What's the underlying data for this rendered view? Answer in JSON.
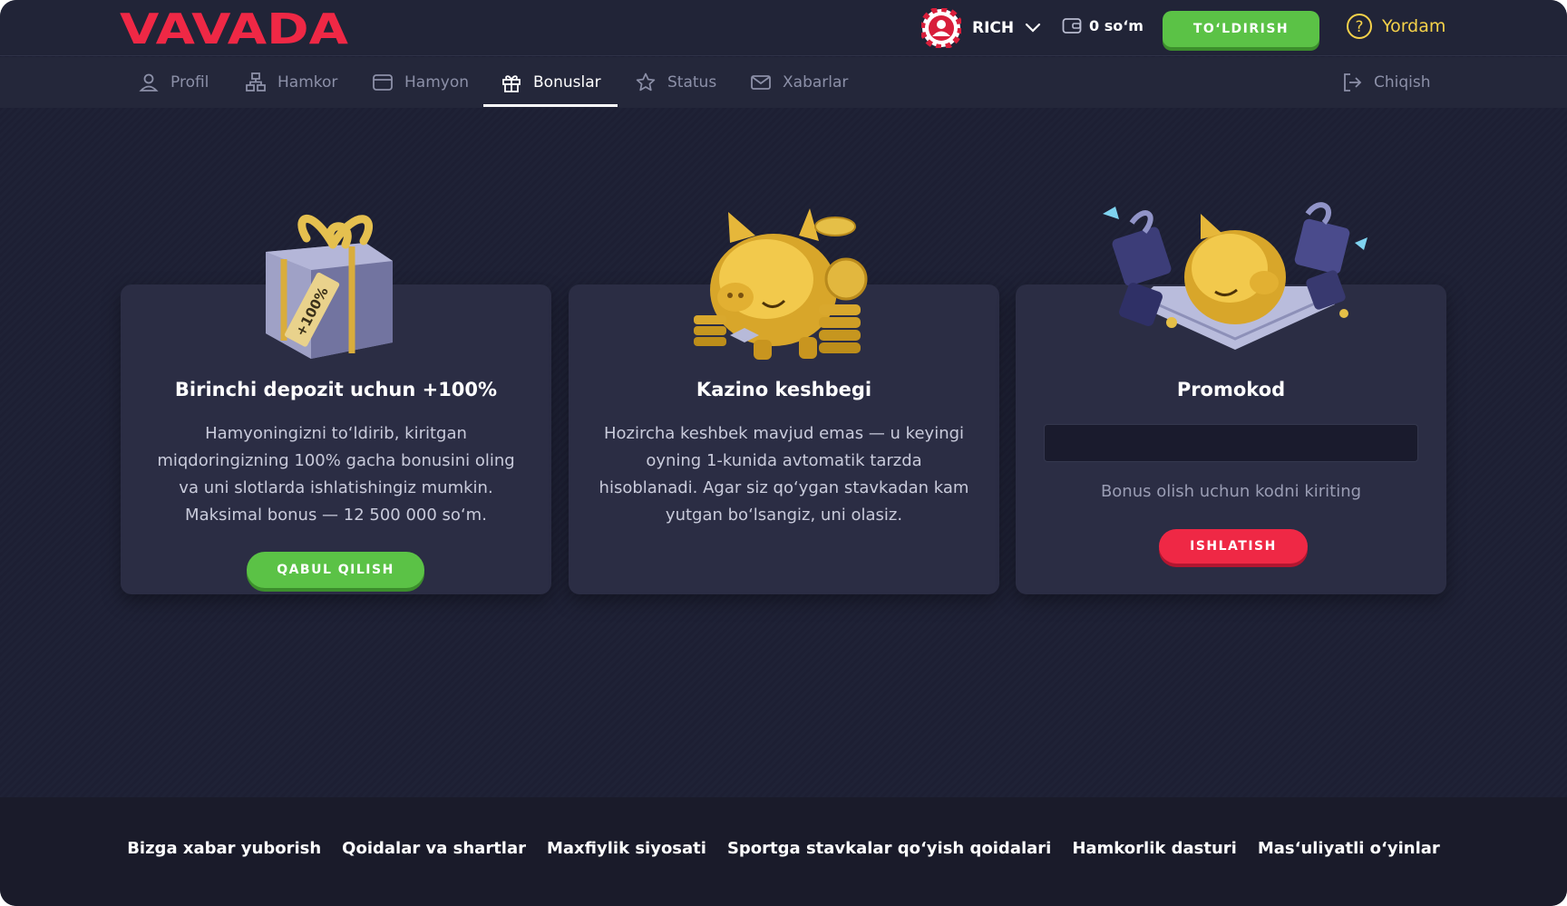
{
  "header": {
    "logo_text": "VAVADA",
    "username": "RICH",
    "balance": "0 so‘m",
    "topup_label": "TO‘LDIRISH",
    "help_label": "Yordam"
  },
  "nav": {
    "items": [
      {
        "label": "Profil",
        "icon": "user-icon"
      },
      {
        "label": "Hamkor",
        "icon": "network-icon"
      },
      {
        "label": "Hamyon",
        "icon": "wallet-icon"
      },
      {
        "label": "Bonuslar",
        "icon": "gift-icon",
        "active": true
      },
      {
        "label": "Status",
        "icon": "star-icon"
      },
      {
        "label": "Xabarlar",
        "icon": "mail-icon"
      }
    ],
    "logout_label": "Chiqish"
  },
  "cards": {
    "deposit": {
      "title": "Birinchi depozit uchun +100%",
      "text": "Hamyoningizni to‘ldirib, kiritgan miqdoringizning 100% gacha bonusini oling va uni slotlarda ishlatishingiz mumkin. Maksimal bonus — 12 500 000 so‘m.",
      "button": "QABUL QILISH",
      "tag_text": "+100%"
    },
    "cashback": {
      "title": "Kazino keshbegi",
      "text": "Hozircha keshbek mavjud emas — u keyingi oyning 1-kunida avtomatik tarzda hisoblanadi. Agar siz qo‘ygan stavkadan kam yutgan bo‘lsangiz, uni olasiz."
    },
    "promo": {
      "title": "Promokod",
      "input_value": "",
      "hint": "Bonus olish uchun kodni kiriting",
      "button": "ISHLATISH"
    }
  },
  "footer": {
    "links": [
      "Bizga xabar yuborish",
      "Qoidalar va shartlar",
      "Maxfiylik siyosati",
      "Sportga stavkalar qo‘yish qoidalari",
      "Hamkorlik dasturi",
      "Mas‘uliyatli o‘yinlar"
    ]
  },
  "colors": {
    "brand_red": "#ef2845",
    "accent_green": "#5bc246",
    "help_yellow": "#f6d24a",
    "background": "#1e2035"
  }
}
